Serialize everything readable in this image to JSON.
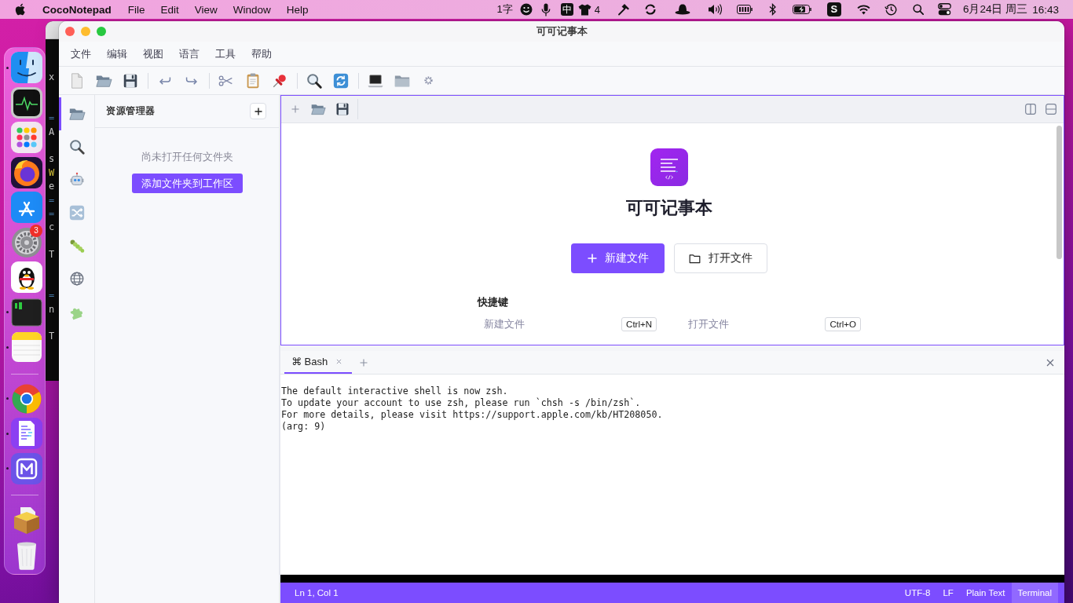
{
  "menu_bar": {
    "app_name": "CocoNotepad",
    "menus": [
      "File",
      "Edit",
      "View",
      "Window",
      "Help"
    ],
    "input_mode": "1字",
    "input_source": "中",
    "shirt_count": "4",
    "ime_logo": "S",
    "date": "6月24日 周三",
    "time": "16:43"
  },
  "background_window": {
    "fragments": [
      {
        "text": "x",
        "kind": "plain"
      },
      {
        "text": "=",
        "kind": "rule"
      },
      {
        "text": "A",
        "kind": "plain"
      },
      {
        "text": "s",
        "kind": "plain"
      },
      {
        "text": "W",
        "kind": "highlight"
      },
      {
        "text": "e",
        "kind": "plain"
      },
      {
        "text": "=",
        "kind": "rule"
      },
      {
        "text": "=",
        "kind": "rule"
      },
      {
        "text": "c",
        "kind": "plain"
      },
      {
        "text": "T",
        "kind": "plain"
      },
      {
        "text": "=",
        "kind": "rule"
      },
      {
        "text": "n",
        "kind": "plain"
      },
      {
        "text": "T",
        "kind": "plain"
      }
    ]
  },
  "dock": {
    "groups": [
      [
        {
          "kind": "files",
          "running": true
        },
        {
          "kind": "monitor",
          "running": false
        },
        {
          "kind": "apps",
          "running": false
        },
        {
          "kind": "fox",
          "running": false
        },
        {
          "kind": "store",
          "running": false
        },
        {
          "kind": "settings",
          "running": false,
          "badge": "3"
        },
        {
          "kind": "chat",
          "running": false
        },
        {
          "kind": "terminal",
          "running": true
        },
        {
          "kind": "notes",
          "running": true
        }
      ],
      [
        {
          "kind": "browser",
          "running": true
        },
        {
          "kind": "notepad",
          "running": true
        },
        {
          "kind": "mark",
          "running": true
        }
      ],
      [
        {
          "kind": "package",
          "running": false
        },
        {
          "kind": "trash",
          "running": false
        }
      ]
    ]
  },
  "window": {
    "title": "可可记事本",
    "menus": [
      "文件",
      "编辑",
      "视图",
      "语言",
      "工具",
      "帮助"
    ]
  },
  "activity_bar": [
    {
      "kind": "explorer",
      "selected": true
    },
    {
      "kind": "search",
      "selected": false
    },
    {
      "kind": "ai",
      "selected": false
    },
    {
      "kind": "git",
      "selected": false
    },
    {
      "kind": "debug",
      "selected": false
    },
    {
      "kind": "remote",
      "selected": false
    },
    {
      "kind": "extensions",
      "selected": false
    }
  ],
  "sidebar": {
    "title": "资源管理器",
    "empty_message": "尚未打开任何文件夹",
    "button": "添加文件夹到工作区"
  },
  "editor": {
    "welcome": {
      "title": "可可记事本",
      "actions": [
        {
          "kind": "primary",
          "label": "新建文件"
        },
        {
          "kind": "secondary",
          "label": "打开文件"
        }
      ],
      "shortcuts_title": "快捷键",
      "shortcuts": [
        {
          "label": "新建文件",
          "keys": "Ctrl+N"
        },
        {
          "label": "打开文件",
          "keys": "Ctrl+O"
        }
      ]
    }
  },
  "terminal": {
    "tabs": [
      {
        "symbol": "⌘",
        "label": "Bash",
        "selected": true
      }
    ],
    "lines": [
      "The default interactive shell is now zsh.",
      "To update your account to use zsh, please run `chsh -s /bin/zsh`.",
      "For more details, please visit https://support.apple.com/kb/HT208050.",
      "(arg: 9)"
    ]
  },
  "status_bar": {
    "position": "Ln 1, Col 1",
    "items": [
      {
        "label": "UTF-8",
        "selected": false
      },
      {
        "label": "LF",
        "selected": false
      },
      {
        "label": "Plain Text",
        "selected": false
      },
      {
        "label": "Terminal",
        "selected": true
      }
    ]
  }
}
